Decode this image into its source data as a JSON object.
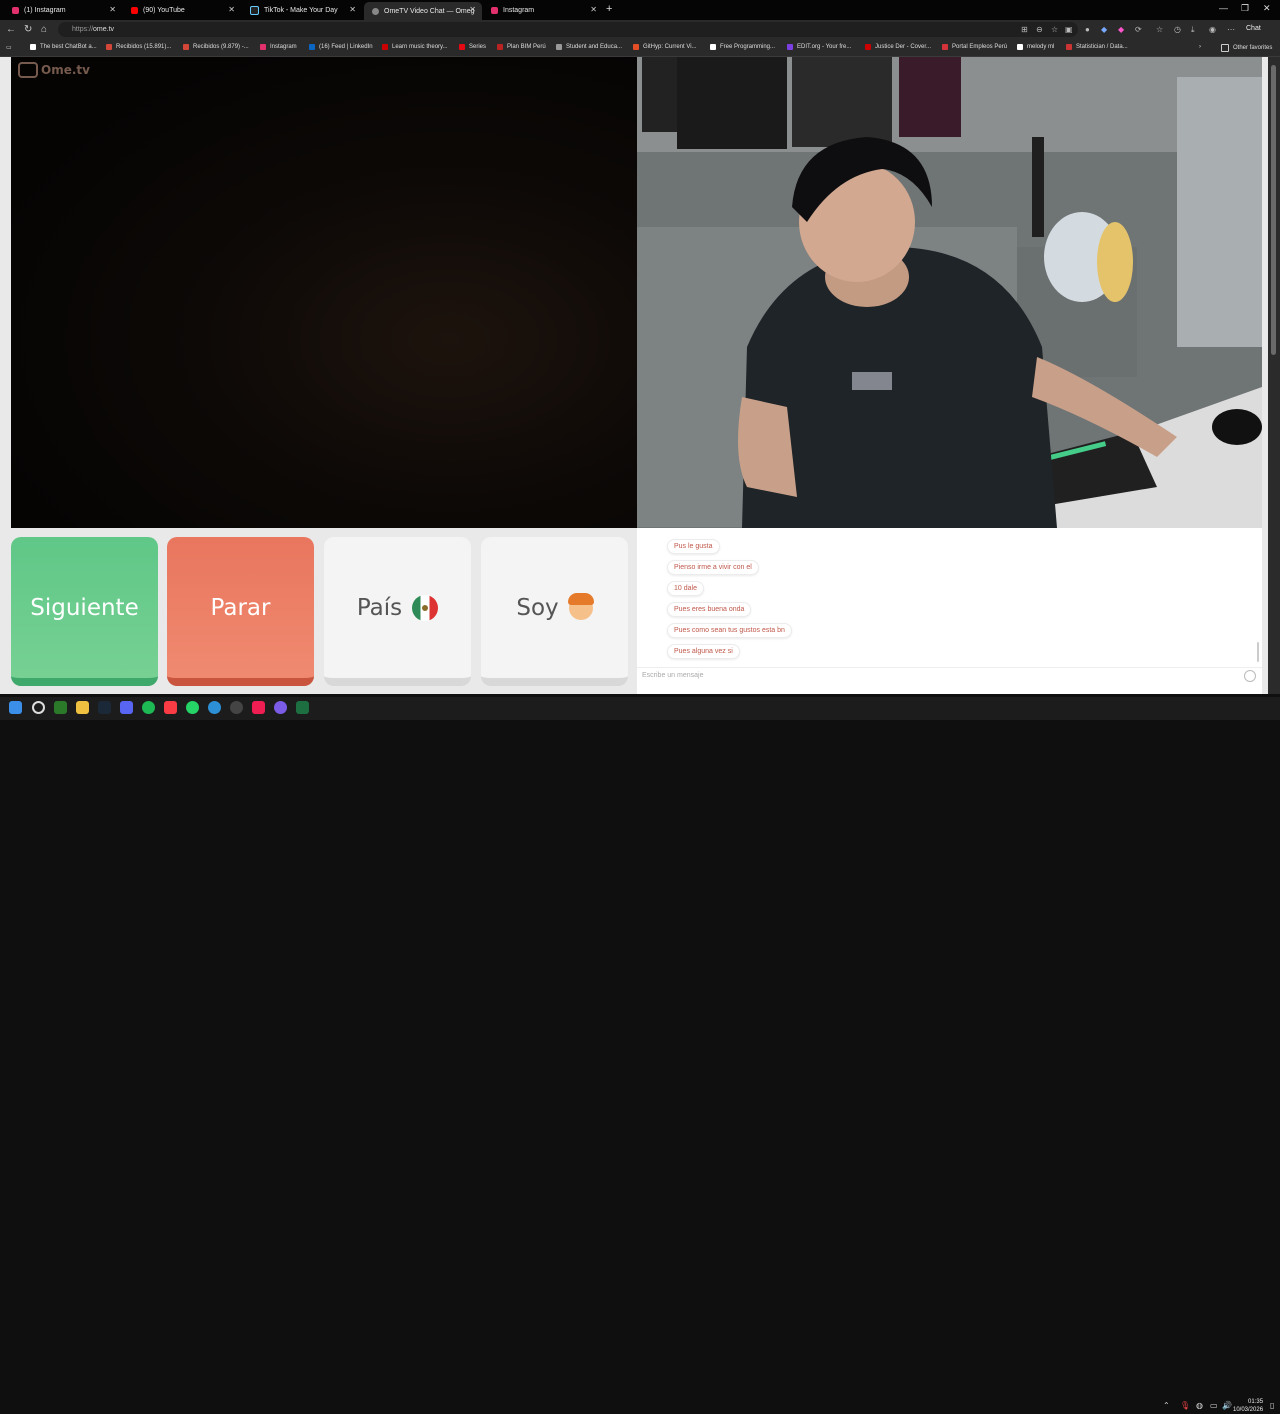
{
  "browser": {
    "tabs": [
      {
        "label": "(1) Instagram",
        "color": "#e1306c",
        "active": false
      },
      {
        "label": "(90) YouTube",
        "color": "#ff0000",
        "active": false
      },
      {
        "label": "TikTok - Make Your Day",
        "color": "#111111",
        "active": false
      },
      {
        "label": "OmeTV Video Chat — Omeg",
        "color": "#888888",
        "active": true
      },
      {
        "label": "Instagram",
        "color": "#e1306c",
        "active": false
      }
    ],
    "new_tab": "+",
    "url_scheme": "https://",
    "url_host": "ome.tv",
    "chat_button": "Chat",
    "bookmarks": [
      {
        "label": "The best ChatBot a...",
        "color": "#ffffff"
      },
      {
        "label": "Recibidos (15.891)...",
        "color": "#d44638"
      },
      {
        "label": "Recibidos (9.879) -...",
        "color": "#d44638"
      },
      {
        "label": "Instagram",
        "color": "#e1306c"
      },
      {
        "label": "(16) Feed | LinkedIn",
        "color": "#0a66c2"
      },
      {
        "label": "Learn music theory...",
        "color": "#cc0000"
      },
      {
        "label": "Series",
        "color": "#e50914"
      },
      {
        "label": "Plan BIM Perú",
        "color": "#bb2222"
      },
      {
        "label": "Student and Educa...",
        "color": "#999999"
      },
      {
        "label": "GitHyp: Current Vi...",
        "color": "#e44d26"
      },
      {
        "label": "Free Programming...",
        "color": "#ffffff"
      },
      {
        "label": "EDIT.org - Your fre...",
        "color": "#7b3fe4"
      },
      {
        "label": "Justice Der - Cover...",
        "color": "#cc0000"
      },
      {
        "label": "Portal Empleos Perú",
        "color": "#d4333a"
      },
      {
        "label": "melody ml",
        "color": "#ffffff"
      },
      {
        "label": "Statistician / Data...",
        "color": "#cc3333"
      }
    ],
    "other_favorites": "Other favorites"
  },
  "app": {
    "logo_text": "Ome.tv",
    "buttons": {
      "next": "Siguiente",
      "stop": "Parar",
      "country": "País",
      "me": "Soy"
    },
    "chat": {
      "messages": [
        "Pus le gusta",
        "Pienso irme a vivir con el",
        "10 dale",
        "Pues eres buena onda",
        "Pues como sean tus gustos esta bn",
        "Pues alguna vez si"
      ],
      "input_placeholder": "Escribe un mensaje"
    }
  },
  "taskbar": {
    "time": "01:35",
    "date": "10/03/2026"
  }
}
